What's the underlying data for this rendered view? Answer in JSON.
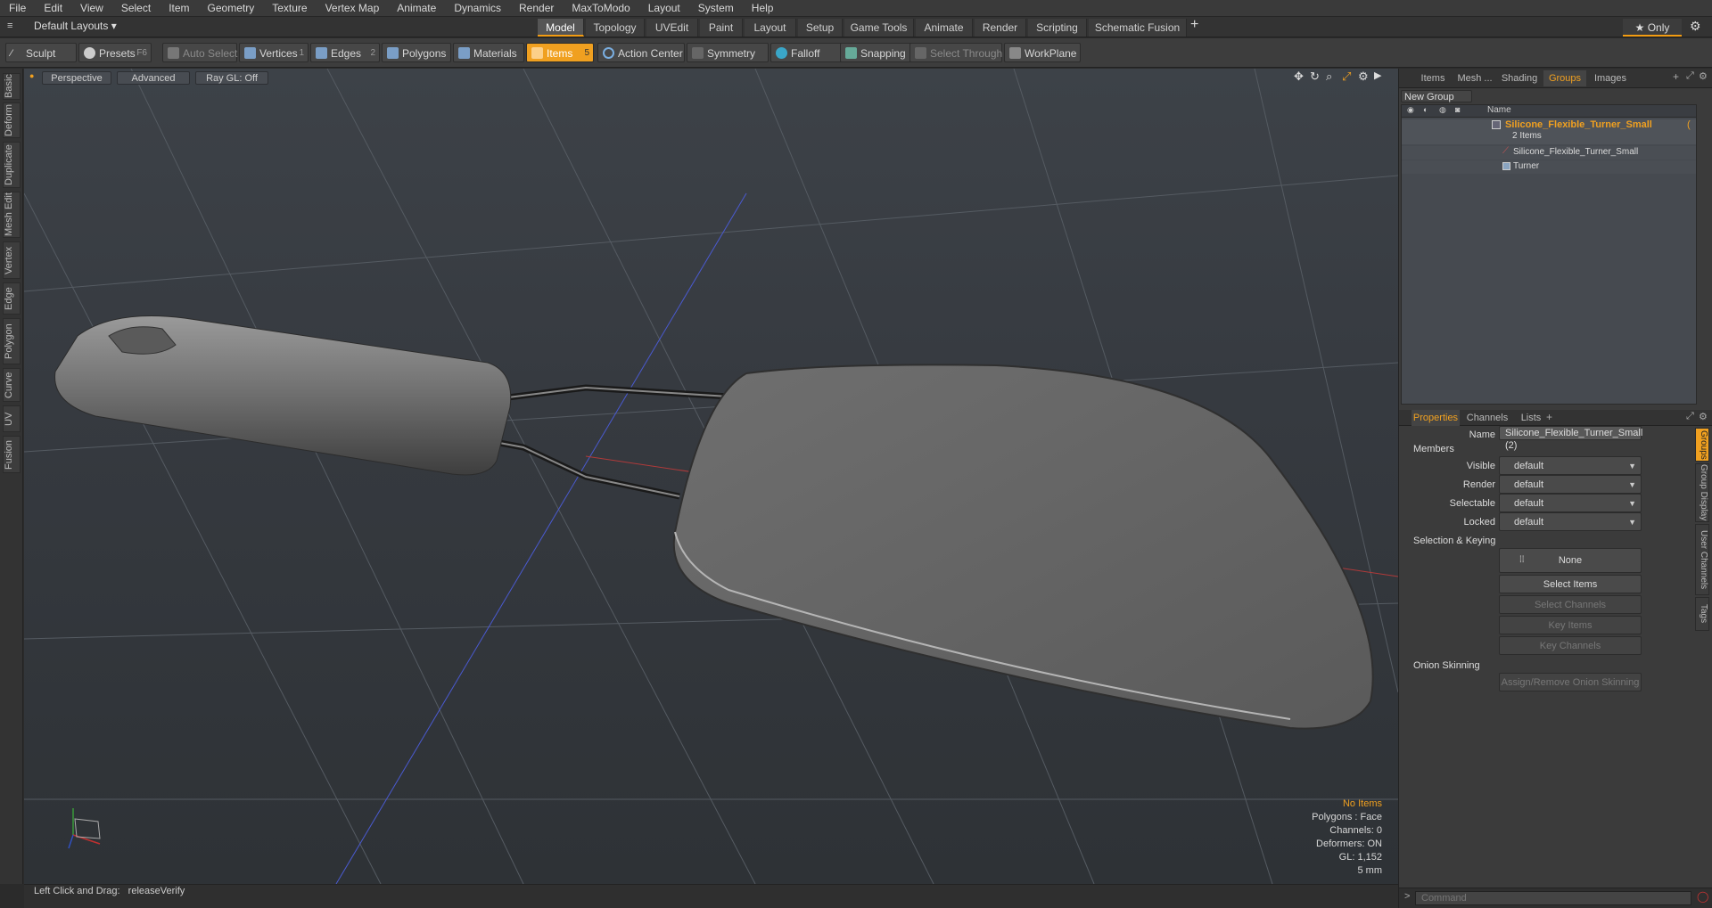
{
  "menu": [
    "File",
    "Edit",
    "View",
    "Select",
    "Item",
    "Geometry",
    "Texture",
    "Vertex Map",
    "Animate",
    "Dynamics",
    "Render",
    "MaxToModo",
    "Layout",
    "System",
    "Help"
  ],
  "layout_selector": "Default Layouts ▾",
  "layout_tabs": [
    "Model",
    "Topology",
    "UVEdit",
    "Paint",
    "Layout",
    "Setup",
    "Game Tools",
    "Animate",
    "Render",
    "Scripting",
    "Schematic Fusion"
  ],
  "layout_tab_active": "Model",
  "only_label": "★  Only",
  "toolbar": {
    "sculpt": "Sculpt",
    "presets": "Presets",
    "presets_key": "F6",
    "auto_select": "Auto Select",
    "vertices": "Vertices",
    "vertices_count": "1",
    "edges": "Edges",
    "edges_count": "2",
    "polygons": "Polygons",
    "materials": "Materials",
    "items": "Items",
    "items_count": "5",
    "action_center": "Action Center",
    "symmetry": "Symmetry",
    "falloff": "Falloff",
    "snapping": "Snapping",
    "select_through": "Select Through",
    "workplane": "WorkPlane"
  },
  "left_tabs": [
    "Basic",
    "Deform",
    "Duplicate",
    "Mesh Edit",
    "Vertex",
    "Edge",
    "Polygon",
    "Curve",
    "UV",
    "Fusion"
  ],
  "viewport": {
    "view": "Perspective",
    "shading": "Advanced",
    "raygl": "Ray GL: Off"
  },
  "hud": {
    "items": "No Items",
    "polygons": "Polygons : Face",
    "channels": "Channels: 0",
    "deformers": "Deformers: ON",
    "gl": "GL: 1,152",
    "unit": "5 mm"
  },
  "status": {
    "hint": "Left Click and Drag:",
    "action": "releaseVerify"
  },
  "panel_tabs": [
    "Items",
    "Mesh ...",
    "Shading",
    "Groups",
    "Images"
  ],
  "panel_tab_active": "Groups",
  "new_group": "New Group",
  "tree": {
    "name_header": "Name",
    "group_name": "Silicone_Flexible_Turner_Small",
    "group_suffix": "(",
    "group_count": "2 Items",
    "children": [
      "Silicone_Flexible_Turner_Small",
      "Turner"
    ]
  },
  "prop_tabs": [
    "Properties",
    "Channels",
    "Lists"
  ],
  "prop_tab_active": "Properties",
  "properties": {
    "name_label": "Name",
    "name_value": "Silicone_Flexible_Turner_Small (2)",
    "members": "Members",
    "visible_label": "Visible",
    "visible_value": "default",
    "render_label": "Render",
    "render_value": "default",
    "selectable_label": "Selectable",
    "selectable_value": "default",
    "locked_label": "Locked",
    "locked_value": "default",
    "sel_keying": "Selection & Keying",
    "none": "None",
    "select_items": "Select Items",
    "select_channels": "Select Channels",
    "key_items": "Key Items",
    "key_channels": "Key Channels",
    "onion": "Onion Skinning",
    "assign_onion": "Assign/Remove Onion Skinning"
  },
  "side_tabs": [
    "Groups",
    "Group Display",
    "User Channels",
    "Tags"
  ],
  "command_placeholder": "Command",
  "colors": {
    "accent": "#f0a020",
    "selected_text": "#f0a020"
  }
}
